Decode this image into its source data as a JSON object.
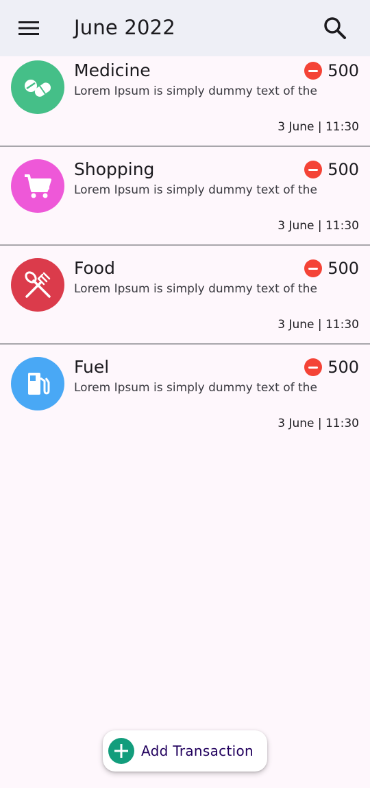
{
  "appbar": {
    "title": "June 2022",
    "menu_icon": "menu-icon",
    "search_icon": "search-icon",
    "background": "#eeeff6"
  },
  "transactions": [
    {
      "title": "Medicine",
      "description": "Lorem Ipsum is simply dummy text of the",
      "amount": "500",
      "datetime": "3 June | 11:30",
      "icon": "pills-icon",
      "color": "#45bf88"
    },
    {
      "title": "Shopping",
      "description": "Lorem Ipsum is simply dummy text of the",
      "amount": "500",
      "datetime": "3 June | 11:30",
      "icon": "shopping-cart-icon",
      "color": "#ee58d8"
    },
    {
      "title": "Food",
      "description": "Lorem Ipsum is simply dummy text of the",
      "amount": "500",
      "datetime": "3 June | 11:30",
      "icon": "fork-spoon-icon",
      "color": "#db3b4b"
    },
    {
      "title": "Fuel",
      "description": "Lorem Ipsum is simply dummy text of the",
      "amount": "500",
      "datetime": "3 June | 11:30",
      "icon": "fuel-pump-icon",
      "color": "#49a8f5"
    }
  ],
  "expense_indicator_color": "#f44336",
  "fab": {
    "label": "Add Transaction",
    "icon": "plus-icon",
    "accent": "#129d7c"
  }
}
